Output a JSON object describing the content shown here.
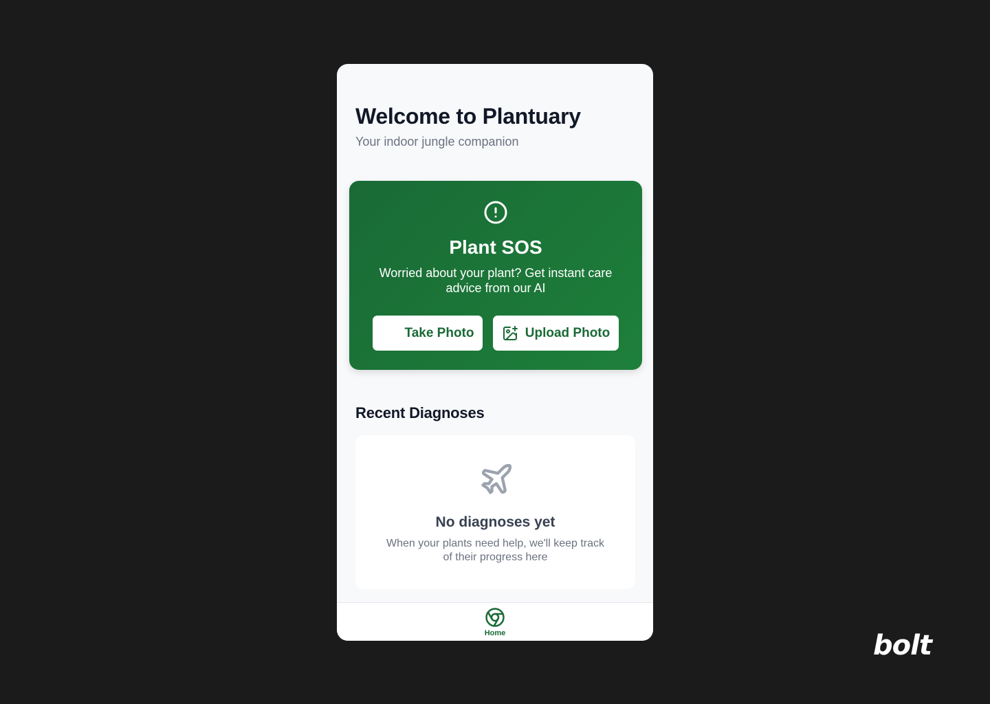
{
  "header": {
    "title": "Welcome to Plantuary",
    "subtitle": "Your indoor jungle companion"
  },
  "sos_card": {
    "icon": "alert-circle-icon",
    "title": "Plant SOS",
    "description": "Worried about your plant? Get instant care advice from our AI",
    "take_photo_label": "Take Photo",
    "upload_photo_icon": "image-plus-icon",
    "upload_photo_label": "Upload Photo"
  },
  "recent": {
    "section_title": "Recent Diagnoses",
    "empty_icon": "plane-icon",
    "empty_title": "No diagnoses yet",
    "empty_description": "When your plants need help, we'll keep track of their progress here"
  },
  "tabbar": {
    "home_icon": "chrome-icon",
    "home_label": "Home"
  },
  "branding": {
    "logo_text": "bolt"
  },
  "colors": {
    "background": "#1b1b1b",
    "screen": "#f8f9fb",
    "brand_green": "#1a6a36",
    "text_dark": "#111827",
    "text_muted": "#6b7280"
  }
}
